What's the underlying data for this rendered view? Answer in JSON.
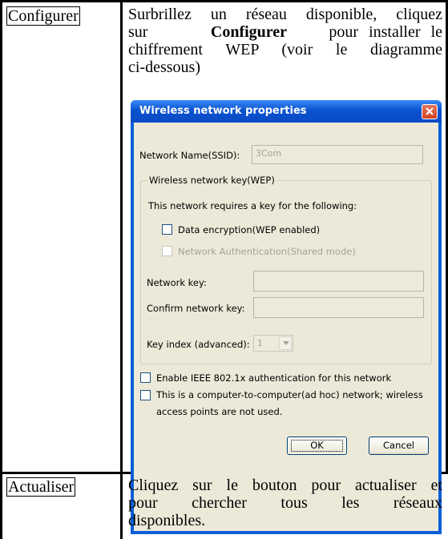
{
  "rows": [
    {
      "term": "Configurer",
      "desc_lines": [
        {
          "pre": "Surbrillez un réseau disponible, cliquez"
        },
        {
          "pre": "sur",
          "bold": "Configurer",
          "post": "pour installer le"
        },
        {
          "pre": "chiffrement WEP (voir le diagramme"
        },
        {
          "pre": "ci-dessous)"
        }
      ]
    },
    {
      "term": "Actualiser",
      "desc_lines": [
        {
          "pre": "Cliquez sur le bouton pour actualiser et"
        },
        {
          "pre": "pour chercher tous les réseaux"
        },
        {
          "pre": "disponibles."
        }
      ]
    }
  ],
  "dialog": {
    "title": "Wireless network properties",
    "close_icon": "close-x-icon",
    "ssid_label": "Network Name(SSID):",
    "ssid_value": "3Com",
    "group_legend": "Wireless network key(WEP)",
    "group_intro": "This network requires a key for the following:",
    "data_encryption_label": "Data encryption(WEP enabled)",
    "data_encryption_checked": false,
    "network_auth_label": "Network Authentication(Shared mode)",
    "network_auth_checked": false,
    "network_key_label": "Network key:",
    "network_key_value": "",
    "confirm_key_label": "Confirm network key:",
    "confirm_key_value": "",
    "key_index_label": "Key index (advanced):",
    "key_index_value": "1",
    "ieee_label": "Enable IEEE 802.1x authentication for this network",
    "ieee_checked": false,
    "adhoc_label_line1": "This is a computer-to-computer(ad hoc) network; wireless",
    "adhoc_label_line2": "access points are not used.",
    "adhoc_checked": false,
    "ok_label": "OK",
    "cancel_label": "Cancel",
    "colors": {
      "title_bar": "#0a52d0",
      "close_button": "#d2401f",
      "body": "#ece9d8"
    }
  }
}
